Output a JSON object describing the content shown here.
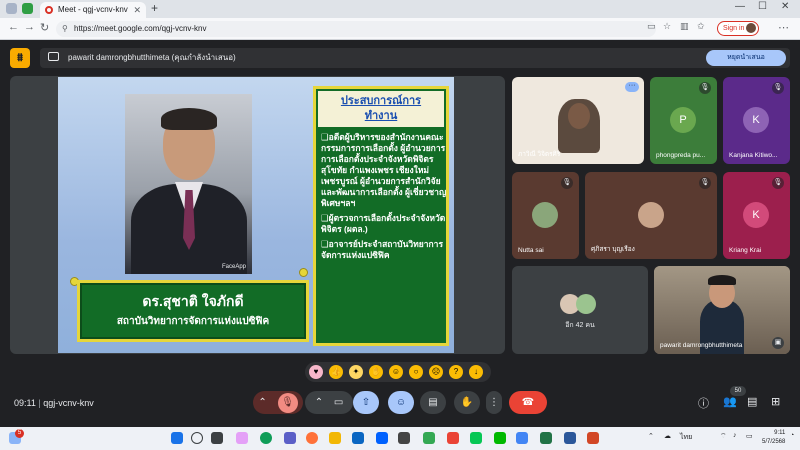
{
  "browser": {
    "tab_title": "Meet - qgj-vcnv-knv",
    "url": "https://meet.google.com/qgj-vcnv-knv",
    "signin_label": "Sign in"
  },
  "meet": {
    "presenting_text": "pawarit damrongbhutthimeta (คุณกำลังนำเสนอ)",
    "stop_presenting_label": "หยุดนำเสนอ",
    "time": "09:11",
    "meeting_code": "qgj-vcnv-knv",
    "participant_count": "50"
  },
  "slide": {
    "watermark": "FaceApp",
    "name": "ดร.สุชาติ ใจภักดี",
    "org": "สถาบันวิทยาการจัดการแห่งแปซิฟิค",
    "exp_title_1": "ประสบการณ์การ",
    "exp_title_2": "ทำงาน",
    "exp_items": [
      "❑อดีตผู้บริหารของสำนักงานคณะกรรมการการเลือกตั้ง ผู้อำนวยการการเลือกตั้งประจำจังหวัดพิจิตร สุโขทัย กำแพงเพชร เชียงใหม่ เพชรบูรณ์ ผู้อำนวยการสำนักวิจัยและพัฒนาการเลือกตั้ง ผู้เชี่ยวชาญพิเศษฯลฯ",
      "❑ผู้ตรวจการเลือกตั้งประจำจังหวัดพิจิตร (ผตล.)",
      "❑อาจารย์ประจำสถาบันวิทยาการจัดการแห่งแปซิฟิค"
    ]
  },
  "participants": [
    {
      "name": "ภาวิณี วิจิตรศิริ"
    },
    {
      "name": "phongpreda pu...",
      "initial": "P"
    },
    {
      "name": "Kanjana Kitiwo...",
      "initial": "K"
    },
    {
      "name": "Nutta sai"
    },
    {
      "name": "ศุภิสรา บุญเรือง"
    },
    {
      "name": "Kriang Krai",
      "initial": "K"
    },
    {
      "name": "อีก 42 คน"
    },
    {
      "name": "pawarit damrongbhutthimeta"
    }
  ],
  "tray": {
    "lang": "ไทย",
    "time": "9:11",
    "date": "5/7/2568",
    "notif": "5"
  },
  "colors": {
    "meet_bg": "#202124",
    "slide_green": "#126c26",
    "slide_border": "#e6d63a",
    "leave_red": "#ea4335",
    "present_blue": "#a8c7fa"
  }
}
